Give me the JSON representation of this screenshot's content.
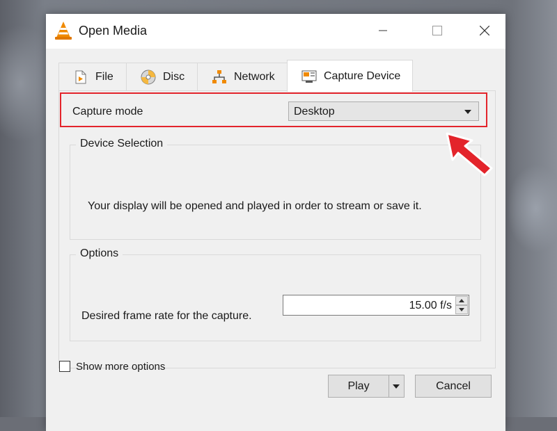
{
  "window": {
    "title": "Open Media"
  },
  "tabs": [
    {
      "label": "File",
      "icon": "file-icon"
    },
    {
      "label": "Disc",
      "icon": "disc-icon"
    },
    {
      "label": "Network",
      "icon": "network-icon"
    },
    {
      "label": "Capture Device",
      "icon": "capture-device-icon",
      "active": true
    }
  ],
  "capture": {
    "label": "Capture mode",
    "value": "Desktop"
  },
  "device_selection": {
    "title": "Device Selection",
    "message": "Your display will be opened and played in order to stream or save it."
  },
  "options": {
    "title": "Options",
    "fps_label": "Desired frame rate for the capture.",
    "fps_value": "15.00 f/s"
  },
  "footer": {
    "show_more_label": "Show more options",
    "show_more_checked": false,
    "play_label": "Play",
    "cancel_label": "Cancel"
  },
  "colors": {
    "highlight": "#e3242b",
    "vlc_orange": "#f08a00"
  }
}
